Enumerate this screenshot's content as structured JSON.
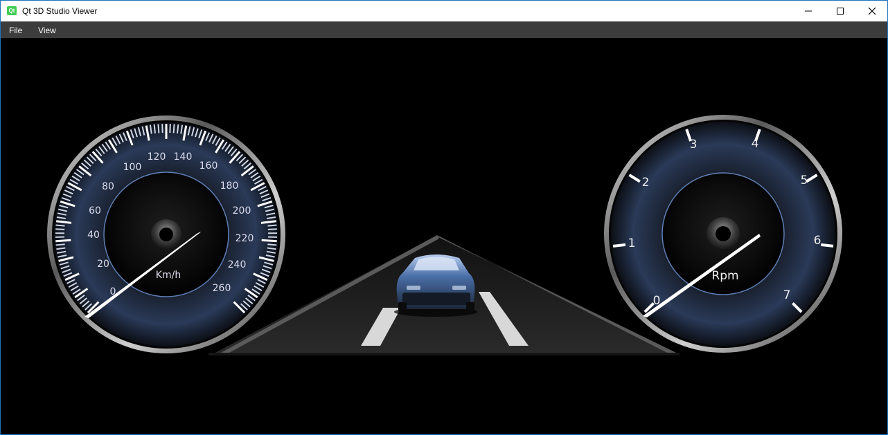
{
  "window": {
    "title": "Qt 3D Studio Viewer",
    "icon": "qt-logo-icon"
  },
  "menu": {
    "items": [
      "File",
      "View"
    ]
  },
  "speedometer": {
    "unit": "Km/h",
    "labels": [
      "0",
      "20",
      "40",
      "60",
      "80",
      "100",
      "120",
      "140",
      "160",
      "180",
      "200",
      "220",
      "240",
      "260"
    ],
    "value": 0
  },
  "tachometer": {
    "unit": "Rpm",
    "labels": [
      "0",
      "1",
      "2",
      "3",
      "4",
      "5",
      "6",
      "7"
    ],
    "value": 0
  },
  "colors": {
    "accent": "#1e73be",
    "gauge_glow": "#7aa0d8",
    "needle": "#ffffff",
    "car": "#4a6fa8"
  }
}
